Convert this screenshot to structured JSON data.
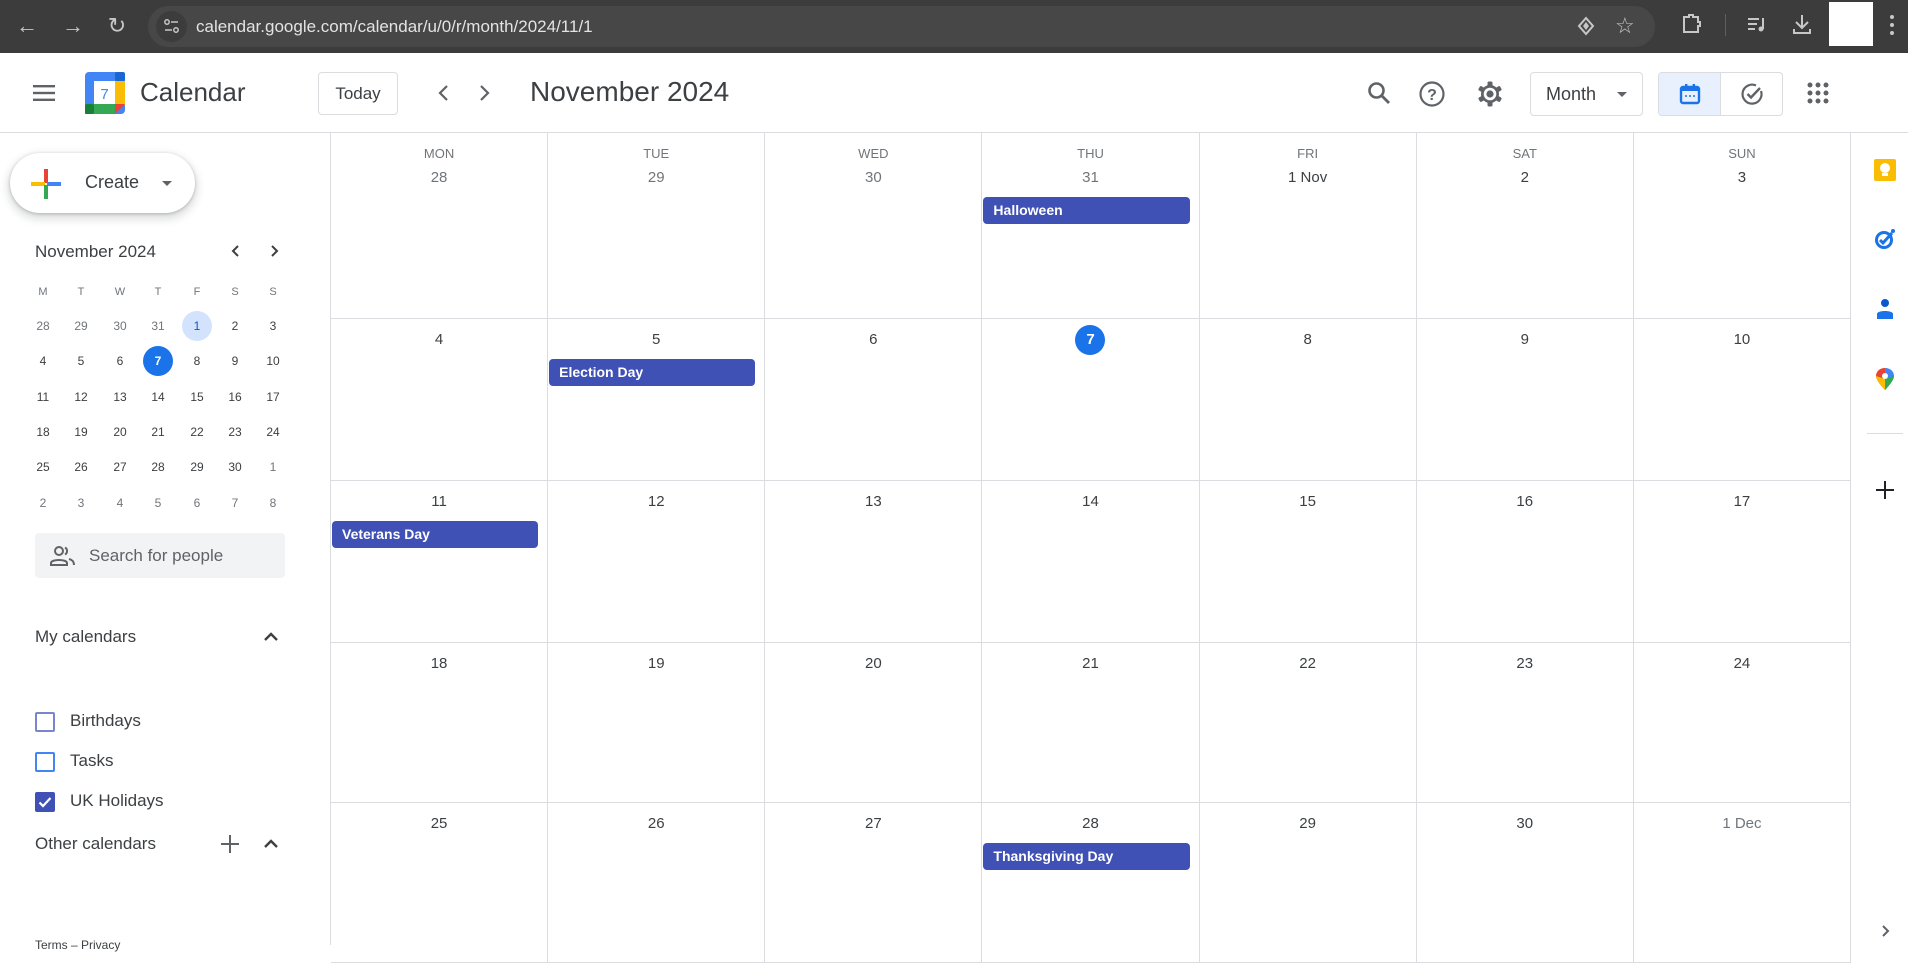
{
  "browser": {
    "url": "calendar.google.com/calendar/u/0/r/month/2024/11/1",
    "icons": [
      "back-icon",
      "forward-icon",
      "reload-icon",
      "site-info-icon",
      "reading-mode-icon",
      "bookmark-star-icon",
      "extensions-icon",
      "media-controls-icon",
      "download-icon",
      "profile-avatar",
      "menu-kebab-icon"
    ]
  },
  "header": {
    "app_name": "Calendar",
    "logo_day": "7",
    "today_label": "Today",
    "period_title": "November 2024",
    "view_label": "Month",
    "icons": [
      "main-menu-icon",
      "prev-icon",
      "next-icon",
      "search-icon",
      "help-icon",
      "settings-icon",
      "calendar-view-icon",
      "tasks-view-icon",
      "apps-grid-icon"
    ]
  },
  "sidebar": {
    "create_label": "Create",
    "mini_calendar": {
      "title": "November 2024",
      "weekdays": [
        "M",
        "T",
        "W",
        "T",
        "F",
        "S",
        "S"
      ],
      "weeks": [
        [
          {
            "d": "28",
            "o": true
          },
          {
            "d": "29",
            "o": true
          },
          {
            "d": "30",
            "o": true
          },
          {
            "d": "31",
            "o": true
          },
          {
            "d": "1",
            "sel": true
          },
          {
            "d": "2"
          },
          {
            "d": "3"
          }
        ],
        [
          {
            "d": "4"
          },
          {
            "d": "5"
          },
          {
            "d": "6"
          },
          {
            "d": "7",
            "today": true
          },
          {
            "d": "8"
          },
          {
            "d": "9"
          },
          {
            "d": "10"
          }
        ],
        [
          {
            "d": "11"
          },
          {
            "d": "12"
          },
          {
            "d": "13"
          },
          {
            "d": "14"
          },
          {
            "d": "15"
          },
          {
            "d": "16"
          },
          {
            "d": "17"
          }
        ],
        [
          {
            "d": "18"
          },
          {
            "d": "19"
          },
          {
            "d": "20"
          },
          {
            "d": "21"
          },
          {
            "d": "22"
          },
          {
            "d": "23"
          },
          {
            "d": "24"
          }
        ],
        [
          {
            "d": "25"
          },
          {
            "d": "26"
          },
          {
            "d": "27"
          },
          {
            "d": "28"
          },
          {
            "d": "29"
          },
          {
            "d": "30"
          },
          {
            "d": "1",
            "o": true
          }
        ],
        [
          {
            "d": "2",
            "o": true
          },
          {
            "d": "3",
            "o": true
          },
          {
            "d": "4",
            "o": true
          },
          {
            "d": "5",
            "o": true
          },
          {
            "d": "6",
            "o": true
          },
          {
            "d": "7",
            "o": true
          },
          {
            "d": "8",
            "o": true
          }
        ]
      ]
    },
    "people_search_placeholder": "Search for people",
    "my_calendars": {
      "title": "My calendars",
      "items": [
        {
          "label": "Birthdays",
          "checked": false,
          "color": "#7986cb"
        },
        {
          "label": "Tasks",
          "checked": false,
          "color": "#4285f4"
        },
        {
          "label": "UK Holidays",
          "checked": true,
          "color": "#3f51b5"
        }
      ]
    },
    "other_calendars": {
      "title": "Other calendars"
    },
    "footer": "Terms – Privacy"
  },
  "calendar": {
    "weekdays": [
      "MON",
      "TUE",
      "WED",
      "THU",
      "FRI",
      "SAT",
      "SUN"
    ],
    "event_color": "#3f51b5",
    "today_color": "#1a73e8",
    "weeks": [
      [
        {
          "label": "28",
          "other": true
        },
        {
          "label": "29",
          "other": true
        },
        {
          "label": "30",
          "other": true
        },
        {
          "label": "31",
          "other": true,
          "events": [
            "Halloween"
          ]
        },
        {
          "label": "1 Nov"
        },
        {
          "label": "2"
        },
        {
          "label": "3"
        }
      ],
      [
        {
          "label": "4"
        },
        {
          "label": "5",
          "events": [
            "Election Day"
          ]
        },
        {
          "label": "6"
        },
        {
          "label": "7",
          "today": true
        },
        {
          "label": "8"
        },
        {
          "label": "9"
        },
        {
          "label": "10"
        }
      ],
      [
        {
          "label": "11",
          "events": [
            "Veterans Day"
          ]
        },
        {
          "label": "12"
        },
        {
          "label": "13"
        },
        {
          "label": "14"
        },
        {
          "label": "15"
        },
        {
          "label": "16"
        },
        {
          "label": "17"
        }
      ],
      [
        {
          "label": "18"
        },
        {
          "label": "19"
        },
        {
          "label": "20"
        },
        {
          "label": "21"
        },
        {
          "label": "22"
        },
        {
          "label": "23"
        },
        {
          "label": "24"
        }
      ],
      [
        {
          "label": "25"
        },
        {
          "label": "26"
        },
        {
          "label": "27"
        },
        {
          "label": "28",
          "events": [
            "Thanksgiving Day"
          ]
        },
        {
          "label": "29"
        },
        {
          "label": "30"
        },
        {
          "label": "1 Dec",
          "other": true
        }
      ]
    ]
  },
  "side_panel": {
    "apps": [
      "keep-icon",
      "tasks-icon",
      "contacts-icon",
      "maps-icon"
    ],
    "add_label": "+",
    "collapse": "›"
  }
}
